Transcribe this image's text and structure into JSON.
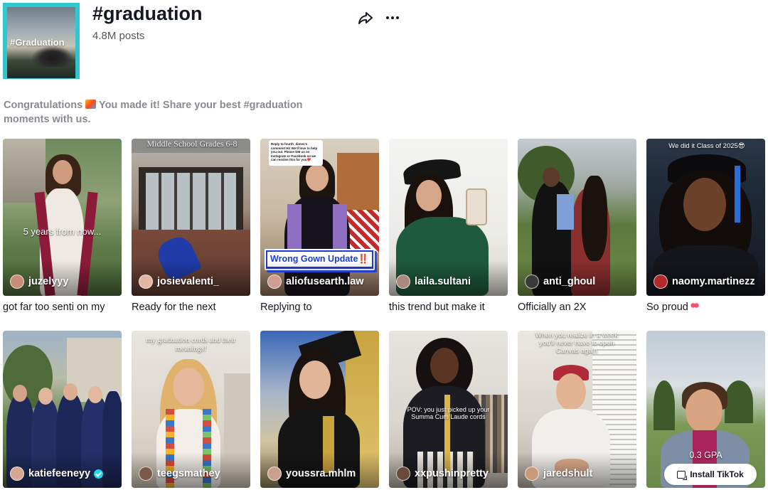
{
  "header": {
    "cover_text": "#Graduation",
    "title": "#graduation",
    "post_count": "4.8M posts"
  },
  "description": {
    "line1_pre": "Congratulations ",
    "line1_post": " You made it! Share your best #graduation",
    "line2": "moments with us."
  },
  "videos": [
    {
      "username": "juzelyyy",
      "caption": "got far too senti on my",
      "overlay": "5 years from now..."
    },
    {
      "username": "josievalenti_",
      "caption": "Ready for the next",
      "overlay": "Middle School Grades 6-8"
    },
    {
      "username": "aliofusearth.law",
      "caption": "Replying to",
      "overlay": "Wrong Gown Update‼️",
      "comment": "Reply to fourth_dimen's comment Hi! We'd love to help you out. Please DM us on Instagram or Facebook so we can resolve this for you❤️"
    },
    {
      "username": "laila.sultani",
      "caption": "this trend but make it",
      "overlay": ""
    },
    {
      "username": "anti_ghoul",
      "caption": "Officially an 2X",
      "overlay": ""
    },
    {
      "username": "naomy.martinezz",
      "caption": "So proud",
      "overlay": "We did it Class of 2025😎"
    },
    {
      "username": "katiefeeneyy",
      "caption": "",
      "overlay": "",
      "verified": true
    },
    {
      "username": "teegsmathey",
      "caption": "",
      "overlay": "my graduation cords and their meanings!"
    },
    {
      "username": "youssra.mhlm",
      "caption": "",
      "overlay": ""
    },
    {
      "username": "xxpushinpretty",
      "caption": "",
      "overlay": "POV: you just picked up your Summa Cum Laude cords"
    },
    {
      "username": "jaredshult",
      "caption": "",
      "overlay": "When you realize in a week you'll never have to open Canvas again"
    },
    {
      "username": "",
      "caption": "",
      "overlay": "0.3 GPA"
    }
  ],
  "install_button": "Install TikTok",
  "colors": {
    "accent": "#fe2c55",
    "cover_teal": "#2ec9cf",
    "text_primary": "#161823",
    "text_secondary": "#8a8b91",
    "banner_blue": "#1e3bd8"
  }
}
